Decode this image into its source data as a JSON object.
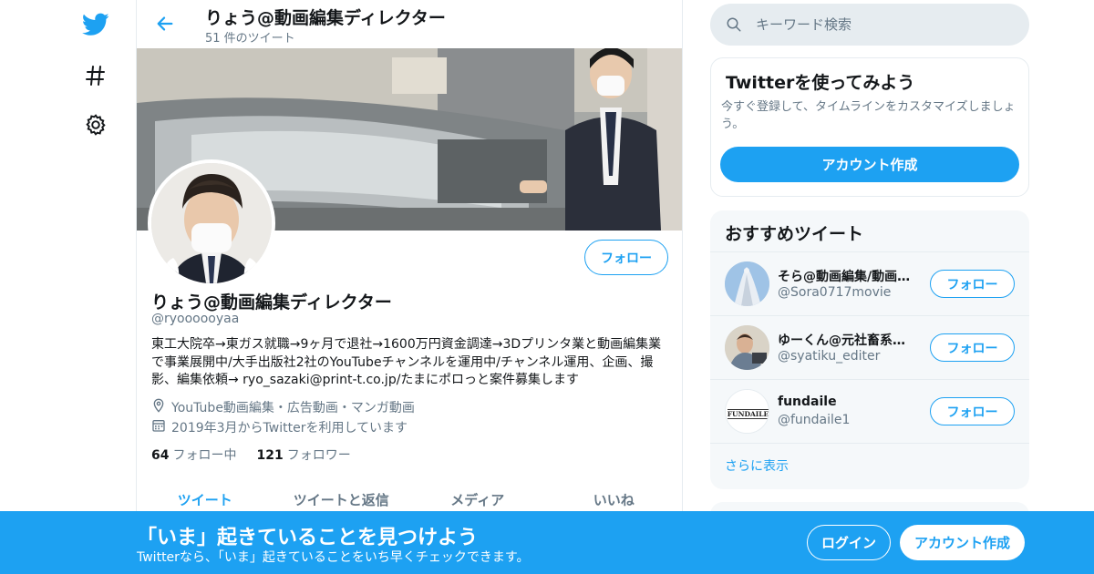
{
  "colors": {
    "accent": "#1da1f2",
    "text_primary": "#14171a",
    "text_secondary": "#657786",
    "border": "#e6ecf0",
    "panel_bg": "#f5f8fa"
  },
  "nav": {
    "icons": [
      "twitter-bird-icon",
      "hashtag-icon",
      "gear-icon"
    ]
  },
  "header": {
    "title": "りょう@動画編集ディレクター",
    "tweet_count": "51 件のツイート"
  },
  "profile": {
    "name": "りょう@動画編集ディレクター",
    "handle": "@ryoooooyaa",
    "follow_label": "フォロー",
    "bio": "東工大院卒→東ガス就職→9ヶ月で退社→1600万円資金調達→3Dプリンタ業と動画編集業で事業展開中/大手出版社2社のYouTubeチャンネルを運用中/チャンネル運用、企画、撮影、編集依頼→ ryo_sazaki@print-t.co.jp/たまにポロっと案件募集します",
    "location": "YouTube動画編集・広告動画・マンガ動画",
    "joined": "2019年3月からTwitterを利用しています",
    "following_count": "64",
    "following_label": "フォロー中",
    "followers_count": "121",
    "followers_label": "フォロワー"
  },
  "tabs": [
    {
      "label": "ツイート",
      "active": true
    },
    {
      "label": "ツイートと返信",
      "active": false
    },
    {
      "label": "メディア",
      "active": false
    },
    {
      "label": "いいね",
      "active": false
    }
  ],
  "search": {
    "placeholder": "キーワード検索"
  },
  "signup_card": {
    "title": "Twitterを使ってみよう",
    "description": "今すぐ登録して、タイムラインをカスタマイズしましょう。",
    "button": "アカウント作成"
  },
  "recommendations": {
    "title": "おすすめツイート",
    "items": [
      {
        "name": "そら@動画編集/動画…",
        "handle": "@Sora0717movie",
        "follow": "フォロー"
      },
      {
        "name": "ゆーくん@元社畜系…",
        "handle": "@syatiku_editer",
        "follow": "フォロー"
      },
      {
        "name": "fundaile",
        "handle": "@fundaile1",
        "follow": "フォロー",
        "avatar_logo": "FUNDAILE"
      }
    ],
    "more": "さらに表示"
  },
  "bottom_bar": {
    "title": "「いま」起きていることを見つけよう",
    "subtitle": "Twitterなら、「いま」起きていることをいち早くチェックできます。",
    "login": "ログイン",
    "signup": "アカウント作成"
  }
}
